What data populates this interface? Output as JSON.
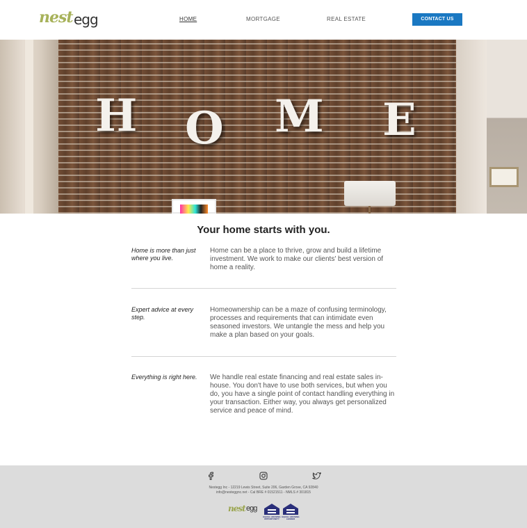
{
  "header": {
    "logo_nest": "nest",
    "logo_egg": "egg",
    "nav": [
      "HOME",
      "MORTGAGE",
      "REAL ESTATE"
    ],
    "contact_label": "CONTACT US",
    "accent_color": "#1a78c2",
    "logo_color": "#a7b25a"
  },
  "hero": {
    "letters": [
      "H",
      "O",
      "M",
      "E"
    ]
  },
  "main": {
    "title": "Your home starts with you.",
    "sections": [
      {
        "label": "Home is more than just where you live.",
        "body": "Home can be a place to thrive, grow and build a lifetime investment. We work to make our clients' best version of home a reality."
      },
      {
        "label": "Expert advice at every step.",
        "body": "Homeownership can be a maze of confusing terminology, processes and requirements that can intimidate even seasoned investors. We untangle the mess and help you make a plan based on your goals."
      },
      {
        "label": "Everything is right here.",
        "body": "We handle real estate financing and real estate sales in-house. You don't have to use both services, but when you do, you have a single point of contact handling everything in your transaction. Either way, you always get personalized service and peace of mind."
      }
    ]
  },
  "footer": {
    "social_icons": [
      "facebook-icon",
      "instagram-icon",
      "twitter-icon"
    ],
    "address": "Nestegg Inc - 12219 Lewis Street, Suite 206, Garden Grove, CA 92840",
    "contact": "info@nesteggnc.net - Cal BRE # 01521511 - NMLS # 301815",
    "logo_nest": "nest",
    "logo_egg": "egg",
    "badge_housing": "EQUAL HOUSING OPPORTUNITY",
    "badge_lender": "EQUAL HOUSING LENDER"
  }
}
